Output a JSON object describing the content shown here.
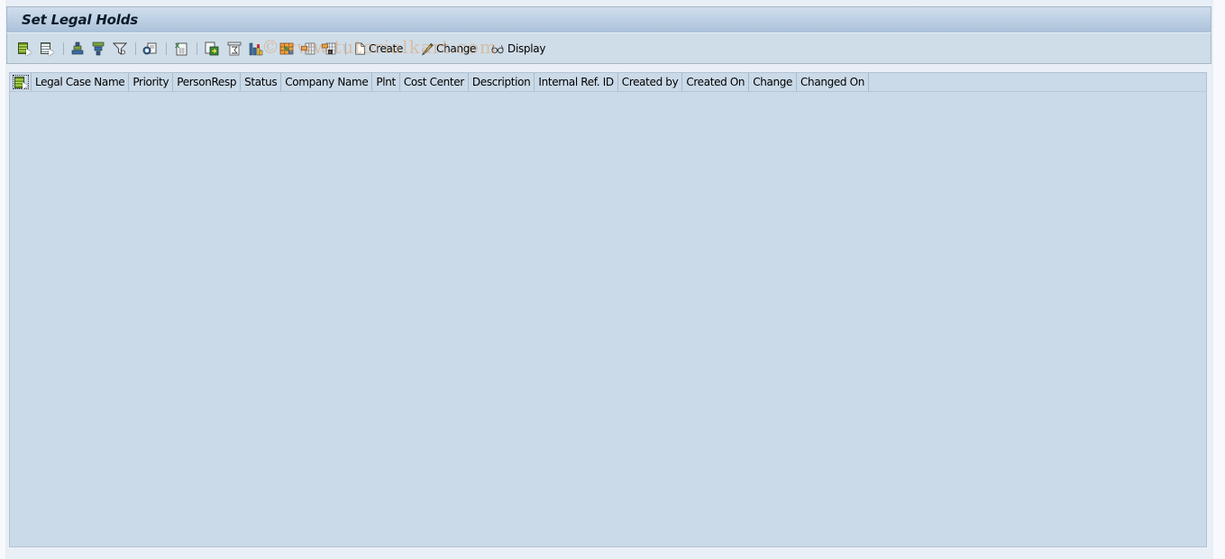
{
  "window": {
    "title": "Set Legal Holds"
  },
  "toolbar": {
    "icons": [
      {
        "name": "details-icon",
        "tooltip": ""
      },
      {
        "name": "select-layout-icon"
      },
      {
        "name": "sort-ascending-icon"
      },
      {
        "name": "sort-descending-icon"
      },
      {
        "name": "filter-icon"
      },
      {
        "name": "print-preview-icon"
      },
      {
        "name": "export-spreadsheet-icon"
      },
      {
        "name": "local-file-icon"
      },
      {
        "name": "total-icon"
      },
      {
        "name": "chart-icon"
      },
      {
        "name": "layout-icon"
      },
      {
        "name": "choose-layout-icon"
      },
      {
        "name": "save-layout-icon"
      }
    ],
    "create_label": "Create",
    "change_label": "Change",
    "display_label": "Display"
  },
  "grid": {
    "columns": [
      "Legal Case Name",
      "Priority",
      "PersonResp",
      "Status",
      "Company Name",
      "Plnt",
      "Cost Center",
      "Description",
      "Internal Ref. ID",
      "Created by",
      "Created On",
      "Change",
      "Changed On"
    ],
    "rows": []
  },
  "watermark": "©www.tutorialkart.com",
  "colors": {
    "title_bar": "#abc2da",
    "toolbar": "#cfdde8",
    "grid_bg": "#cbdae8"
  }
}
